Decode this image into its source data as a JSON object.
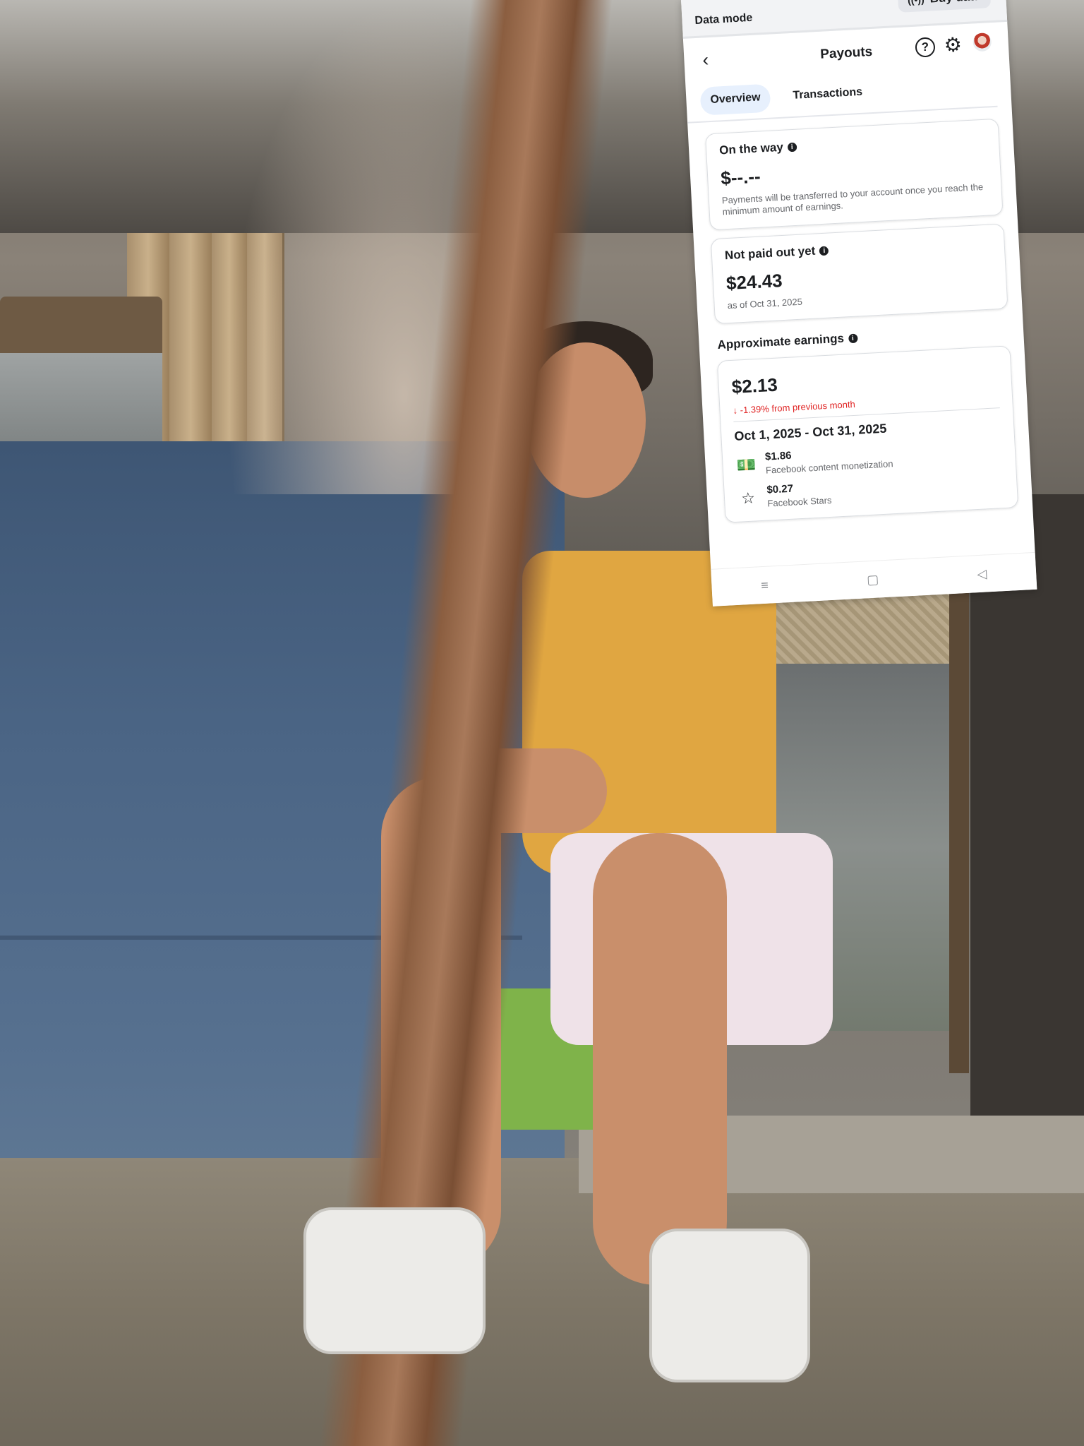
{
  "status_bar": {
    "data_mode_label": "Data mode",
    "buy_data_label": "Buy data",
    "buy_data_icon": "signal-tower-icon"
  },
  "header": {
    "back_icon": "chevron-left-icon",
    "title": "Payouts",
    "help_icon": "help-icon",
    "settings_icon": "gear-icon",
    "avatar": "profile-avatar"
  },
  "tabs": [
    {
      "label": "Overview",
      "active": true
    },
    {
      "label": "Transactions",
      "active": false
    }
  ],
  "on_the_way": {
    "heading": "On the way",
    "amount": "$--.--",
    "note": "Payments will be transferred to your account once you reach the minimum amount of earnings."
  },
  "not_paid_out": {
    "heading": "Not paid out yet",
    "amount": "$24.43",
    "as_of": "as of Oct 31, 2025"
  },
  "approximate_earnings": {
    "heading": "Approximate earnings",
    "amount": "$2.13",
    "change": "↓ -1.39% from previous month",
    "period": "Oct 1, 2025 - Oct 31, 2025",
    "items": [
      {
        "icon": "money-icon",
        "amount": "$1.86",
        "label": "Facebook content monetization"
      },
      {
        "icon": "star-icon",
        "amount": "$0.27",
        "label": "Facebook Stars"
      }
    ]
  },
  "system_nav": {
    "menu_icon": "≡",
    "home_icon": "▢",
    "back_icon": "◁"
  },
  "colors": {
    "negative": "#e02424",
    "active_tab_bg": "#e7f0fd"
  }
}
